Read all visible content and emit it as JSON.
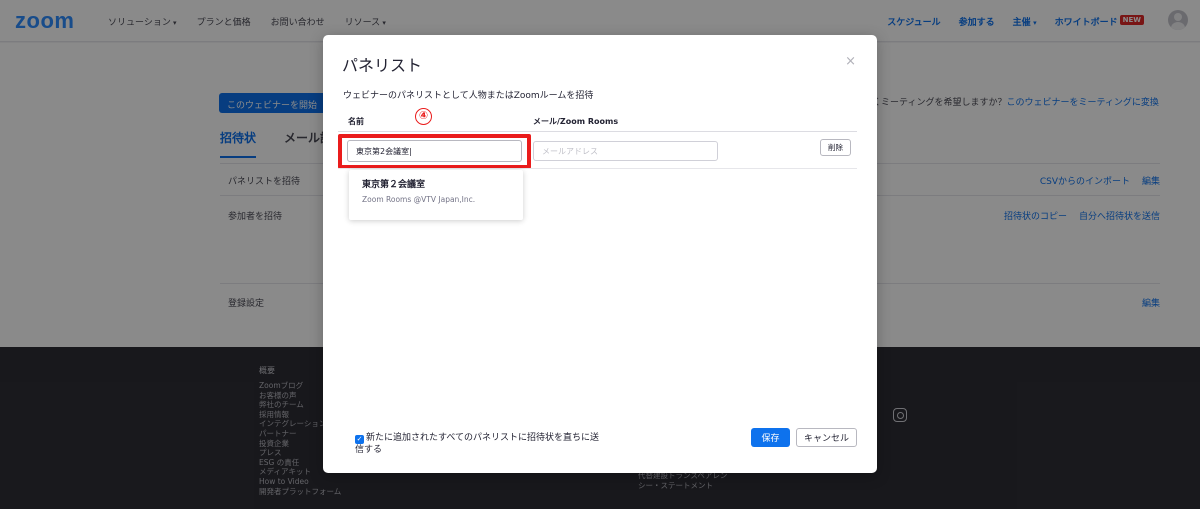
{
  "topnav": {
    "logo": "zoom",
    "left_items": [
      "ソリューション",
      "プランと価格",
      "お問い合わせ",
      "リソース"
    ],
    "right_items": [
      "スケジュール",
      "参加する",
      "主催",
      "ホワイトボード"
    ],
    "new_badge": "NEW"
  },
  "page": {
    "convert_button": "このウェビナーを開始",
    "convert_prompt": "くミーティングを希望しますか？",
    "convert_link": "このウェビナーをミーティングに変換",
    "tabs": [
      "招待状",
      "メール設"
    ],
    "rows": [
      {
        "label": "パネリストを招待",
        "actions": [
          "CSVからのインポート",
          "編集"
        ]
      },
      {
        "label": "参加者を招待",
        "actions": [
          "招待状のコピー",
          "自分へ招待状を送信"
        ]
      },
      {
        "label": "登録設定",
        "actions": [
          "編集"
        ]
      }
    ]
  },
  "footer": {
    "heading": "概要",
    "links": [
      "Zoomブログ",
      "お客様の声",
      "弊社のチーム",
      "採用情報",
      "インテグレーション",
      "パートナー",
      "投資企業",
      "プレス",
      "ESG の責任",
      "メディアキット",
      "How to Video",
      "開発者プラットフォーム"
    ],
    "links2": [
      "代替建設トランスペアレン",
      "シー・ステートメント"
    ]
  },
  "modal": {
    "title": "パネリスト",
    "close": "×",
    "description": "ウェビナーのパネリストとして人物またはZoomルームを招待",
    "col_name": "名前",
    "col_email": "メール/Zoom Rooms",
    "name_value": "東京第2会議室|",
    "email_placeholder": "メールアドレス",
    "delete_label": "削除",
    "step_badge": "④",
    "suggestion_title": "東京第２会議室",
    "suggestion_sub": "Zoom Rooms @VTV Japan,Inc.",
    "checkbox_label": "新たに追加されたすべてのパネリストに招待状を直ちに送信する",
    "save_label": "保存",
    "cancel_label": "キャンセル"
  },
  "colors": {
    "accent": "#0e72ed",
    "highlight": "#ea1c1c"
  }
}
